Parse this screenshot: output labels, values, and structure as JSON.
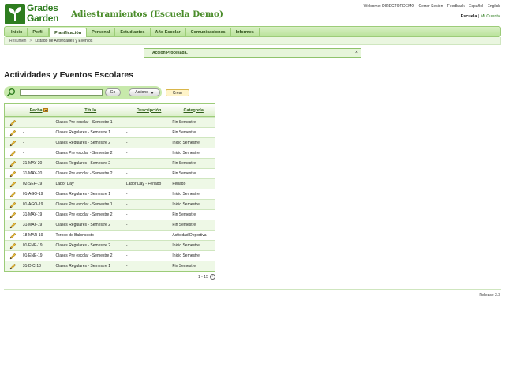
{
  "logo": {
    "line1": "Grades",
    "line2": "Garden"
  },
  "school_title": "Adiestramientos (Escuela Demo)",
  "top_links": {
    "welcome": "Welcome: DIRECTORDEMO",
    "logout": "Cerrar Sesión",
    "feedback": "Feedback",
    "spanish": "Español",
    "english": "English"
  },
  "scope": {
    "school": "Escuela",
    "separator": " | ",
    "my_school": "Mi Cuenta"
  },
  "nav": {
    "items": [
      {
        "label": "Inicio"
      },
      {
        "label": "Perfil"
      },
      {
        "label": "Planificación"
      },
      {
        "label": "Personal"
      },
      {
        "label": "Estudiantes"
      },
      {
        "label": "Año Escolar"
      },
      {
        "label": "Comunicaciones"
      },
      {
        "label": "Informes"
      }
    ],
    "active_index": 2
  },
  "breadcrumb": {
    "root": "Resumen",
    "sep": ">",
    "current": "Listado de Actividades y Eventos"
  },
  "flash": {
    "message": "Acción Procesada.",
    "close": "×"
  },
  "page_title": "Actividades y Eventos Escolares",
  "toolbar": {
    "search_value": "",
    "go_label": "Go",
    "actions_label": "Actions",
    "create_label": "Crear"
  },
  "table": {
    "headers": [
      "Fecha",
      "Título",
      "Descripción",
      "Categoría"
    ],
    "rows": [
      [
        "-",
        "Clases Pre escolar - Semestre 1",
        "-",
        "Fin Semestre"
      ],
      [
        "-",
        "Clases Regulares - Semestre 1",
        "-",
        "Fin Semestre"
      ],
      [
        "-",
        "Clases Regulares - Semestre 2",
        "-",
        "Inicio Semestre"
      ],
      [
        "-",
        "Clases Pre escolar - Semestre 2",
        "-",
        "Inicio Semestre"
      ],
      [
        "31-MAY-20",
        "Clases Regulares - Semestre 2",
        "-",
        "Fin Semestre"
      ],
      [
        "31-MAY-20",
        "Clases Pre escolar - Semestre 2",
        "-",
        "Fin Semestre"
      ],
      [
        "02-SEP-19",
        "Labor Day",
        "Labor Day - Feriado",
        "Feriado"
      ],
      [
        "01-AGO-19",
        "Clases Regulares - Semestre 1",
        "-",
        "Inicio Semestre"
      ],
      [
        "01-AGO-19",
        "Clases Pre escolar - Semestre 1",
        "-",
        "Inicio Semestre"
      ],
      [
        "31-MAY-19",
        "Clases Pre escolar - Semestre 2",
        "-",
        "Fin Semestre"
      ],
      [
        "31-MAY-19",
        "Clases Regulares - Semestre 2",
        "-",
        "Fin Semestre"
      ],
      [
        "18-MAR-19",
        "Torneo de Baloncesto",
        "-",
        "Actividad Deportiva"
      ],
      [
        "01-ENE-19",
        "Clases Regulares - Semestre 2",
        "-",
        "Inicio Semestre"
      ],
      [
        "01-ENE-19",
        "Clases Pre escolar - Semestre 2",
        "-",
        "Inicio Semestre"
      ],
      [
        "31-DIC-18",
        "Clases Regulares - Semestre 1",
        "-",
        "Fin Semestre"
      ]
    ]
  },
  "pager": {
    "range": "1 - 15"
  },
  "footer": {
    "release": "Release 3.3"
  },
  "colors": {
    "brand_green": "#2e7d1f",
    "nav_green": "#b9e29a",
    "row_alt": "#eef8e6"
  },
  "icons": [
    "search-icon",
    "edit-pencil-icon",
    "sort-desc-icon",
    "next-page-icon",
    "close-icon",
    "logo-sprout-icon"
  ]
}
